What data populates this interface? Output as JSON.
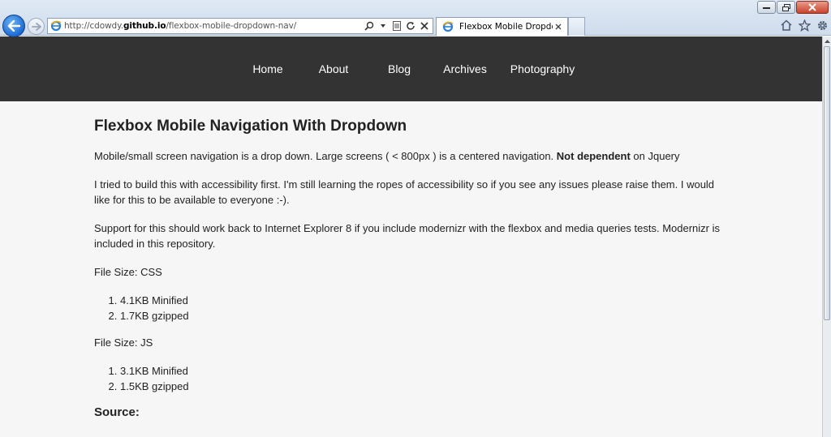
{
  "browser": {
    "url_prefix": "http://cdowdy.",
    "url_host": "github.io",
    "url_path": "/flexbox-mobile-dropdown-nav/",
    "tab_title": "Flexbox Mobile Dropdown ...",
    "icons": {
      "back": "back-arrow-icon",
      "forward": "forward-arrow-icon",
      "search": "search-icon",
      "compat": "compatibility-view-icon",
      "refresh": "refresh-icon",
      "stop": "stop-icon",
      "home": "home-icon",
      "favorites": "star-icon",
      "tools": "gear-icon"
    }
  },
  "site_nav": {
    "items": [
      "Home",
      "About",
      "Blog",
      "Archives",
      "Photography"
    ]
  },
  "article": {
    "title": "Flexbox Mobile Navigation With Dropdown",
    "intro_before": "Mobile/small screen navigation is a drop down. Large screens ( < 800px ) is a centered navigation. ",
    "intro_bold": "Not dependent",
    "intro_after": " on Jquery",
    "accessibility": "I tried to build this with accessibility first. I'm still learning the ropes of accessibility so if you see any issues please raise them. I would like for this to be available to everyone :-).",
    "support": "Support for this should work back to Internet Explorer 8 if you include modernizr with the flexbox and media queries tests. Modernizr is included in this repository.",
    "css_size_label": "File Size: CSS",
    "css_sizes": [
      "4.1KB Minified",
      "1.7KB gzipped"
    ],
    "js_size_label": "File Size: JS",
    "js_sizes": [
      "3.1KB Minified",
      "1.5KB gzipped"
    ],
    "source_heading": "Source:"
  },
  "colors": {
    "nav_background": "#333333",
    "page_background": "#f6f6f6",
    "text": "#222222"
  }
}
